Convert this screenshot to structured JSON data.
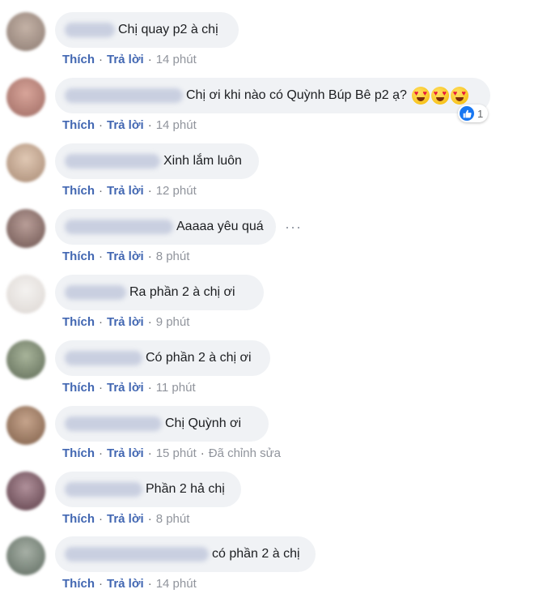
{
  "comments": [
    {
      "text": "Chị quay p2 à chị",
      "like": "Thích",
      "reply": "Trả lời",
      "time": "14 phút"
    },
    {
      "text": "Chị ơi khi nào có Quỳnh Búp Bê p2 ạ?",
      "like": "Thích",
      "reply": "Trả lời",
      "time": "14 phút",
      "reaction_count": "1",
      "emoji": "heart-eyes-emoji"
    },
    {
      "text": "Xinh lắm luôn",
      "like": "Thích",
      "reply": "Trả lời",
      "time": "12 phút"
    },
    {
      "text": "Aaaaa yêu quá",
      "like": "Thích",
      "reply": "Trả lời",
      "time": "8 phút",
      "more": "···"
    },
    {
      "text": "Ra phần 2 à chị ơi",
      "like": "Thích",
      "reply": "Trả lời",
      "time": "9 phút"
    },
    {
      "text": "Có phần 2 à chị ơi",
      "like": "Thích",
      "reply": "Trả lời",
      "time": "11 phút"
    },
    {
      "text": "Chị Quỳnh ơi",
      "like": "Thích",
      "reply": "Trả lời",
      "time": "15 phút",
      "edited": "Đã chỉnh sửa"
    },
    {
      "text": "Phần 2 hả chị",
      "like": "Thích",
      "reply": "Trả lời",
      "time": "8 phút"
    },
    {
      "text": "có phần 2 à chị",
      "like": "Thích",
      "reply": "Trả lời",
      "time": "14 phút"
    }
  ],
  "colors": {
    "link": "#4267b2",
    "bubble": "#f0f2f5",
    "like_reaction": "#1877f2"
  }
}
